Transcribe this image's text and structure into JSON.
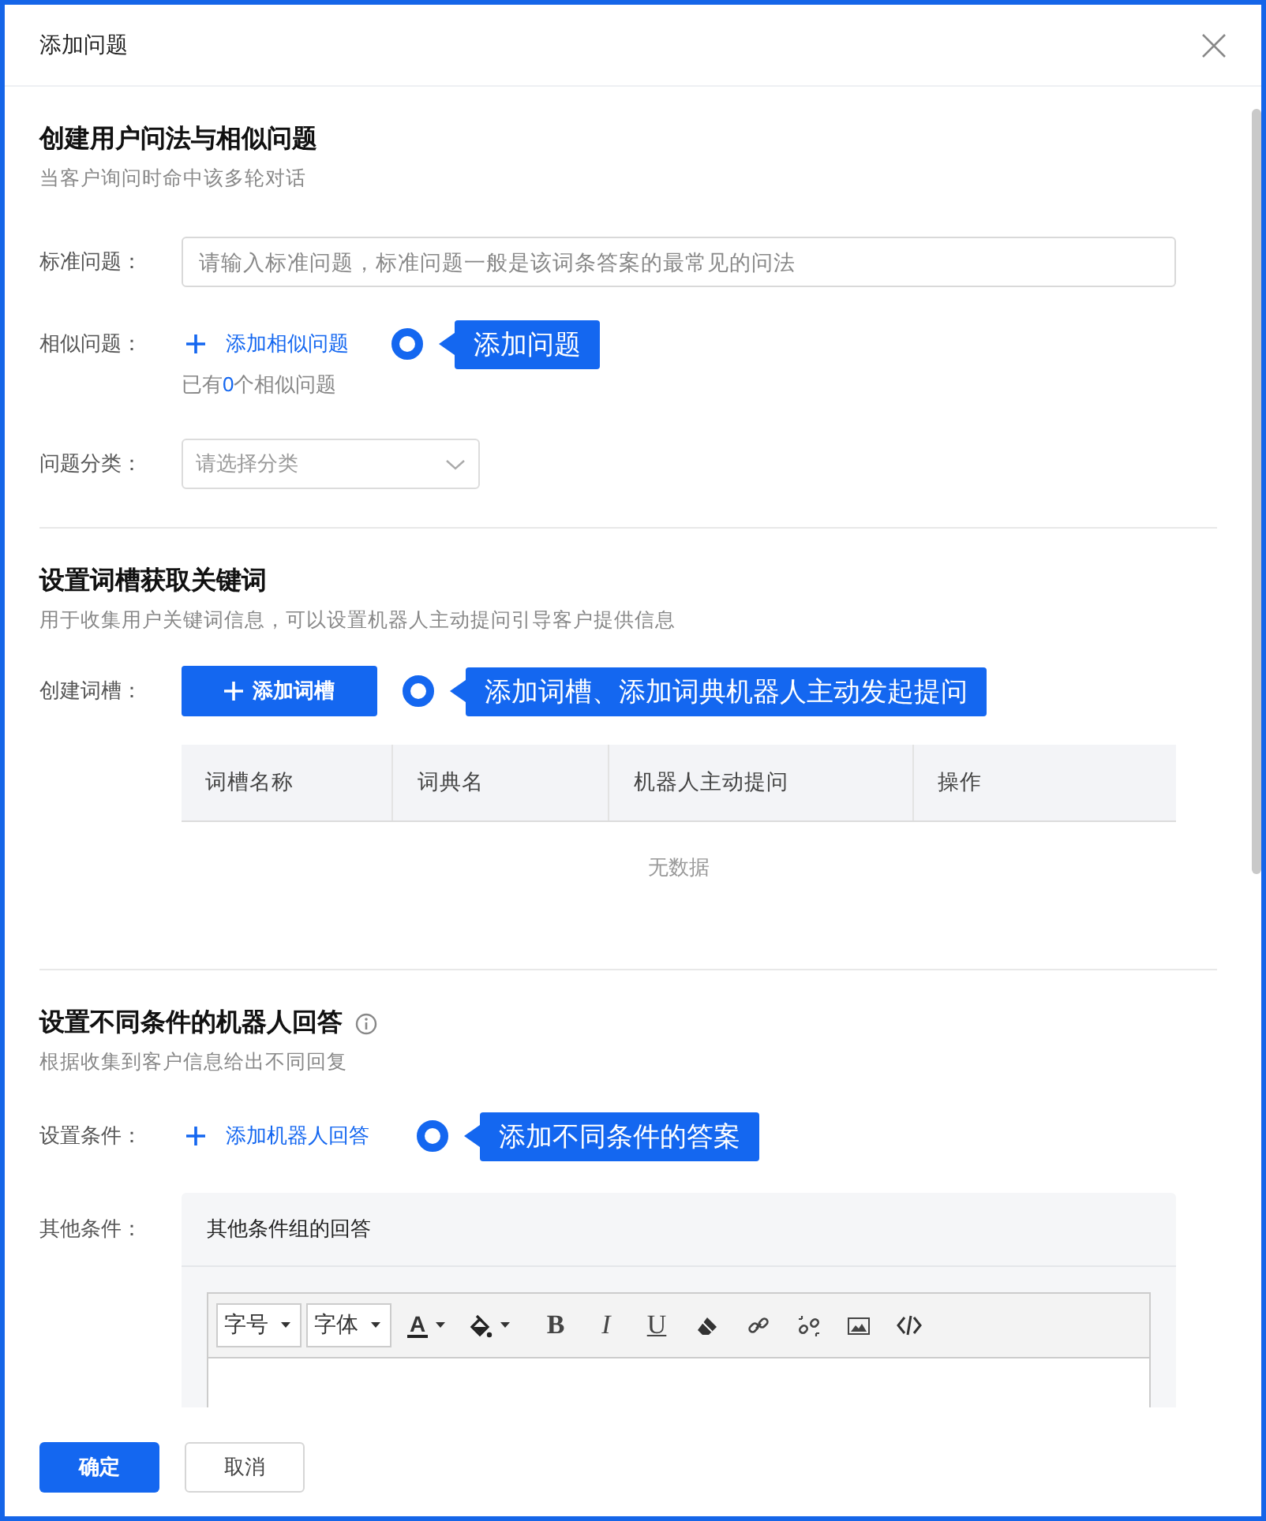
{
  "dialog": {
    "title": "添加问题"
  },
  "sections": [
    {
      "title": "创建用户问法与相似问题",
      "subtitle": "当客户询问时命中该多轮对话",
      "fields": [
        {
          "kind": "input",
          "label": "标准问题：",
          "placeholder": "请输入标准问题，标准问题一般是该词条答案的最常见的问法"
        },
        {
          "kind": "link",
          "label": "相似问题：",
          "link": "添加相似问题",
          "callout": "添加问题",
          "note_prefix": "已有",
          "note_count": "0",
          "note_suffix": "个相似问题"
        },
        {
          "kind": "select",
          "label": "问题分类：",
          "placeholder": "请选择分类"
        }
      ]
    },
    {
      "title": "设置词槽获取关键词",
      "subtitle": "用于收集用户关键词信息，可以设置机器人主动提问引导客户提供信息",
      "fields": [
        {
          "kind": "button",
          "label": "创建词槽：",
          "button": "添加词槽",
          "callout": "添加词槽、添加词典机器人主动发起提问"
        },
        {
          "kind": "table",
          "columns": [
            "词槽名称",
            "词典名",
            "机器人主动提问",
            "操作"
          ],
          "empty": "无数据"
        }
      ]
    },
    {
      "title": "设置不同条件的机器人回答",
      "info_icon": true,
      "subtitle": "根据收集到客户信息给出不同回复",
      "fields": [
        {
          "kind": "link",
          "label": "设置条件：",
          "link": "添加机器人回答",
          "callout": "添加不同条件的答案"
        },
        {
          "kind": "editor",
          "label": "其他条件：",
          "heading": "其他条件组的回答",
          "toolbar": [
            {
              "kind": "dropdown",
              "label": "字号"
            },
            {
              "kind": "dropdown",
              "label": "字体"
            },
            {
              "kind": "text-color",
              "label": "A"
            },
            {
              "kind": "fill-color"
            },
            {
              "kind": "bold",
              "label": "B"
            },
            {
              "kind": "italic",
              "label": "I"
            },
            {
              "kind": "underline",
              "label": "U"
            },
            {
              "kind": "eraser"
            },
            {
              "kind": "link"
            },
            {
              "kind": "unlink"
            },
            {
              "kind": "image"
            },
            {
              "kind": "code"
            }
          ]
        }
      ]
    }
  ],
  "footer": {
    "buttons": [
      {
        "label": "确定",
        "primary": true
      },
      {
        "label": "取消",
        "primary": false
      }
    ]
  }
}
